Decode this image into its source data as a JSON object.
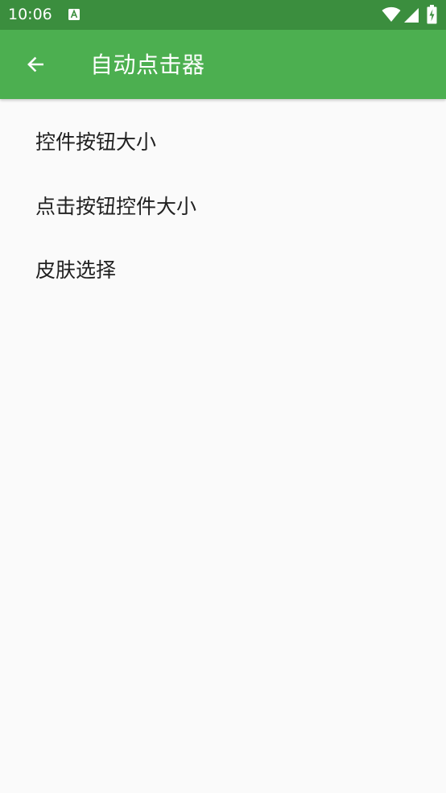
{
  "status_bar": {
    "time": "10:06",
    "notification_icon": "a-in-box-icon",
    "wifi_icon": "wifi-icon",
    "signal_icon": "cell-signal-icon",
    "battery_icon": "battery-charging-icon"
  },
  "app_bar": {
    "back_icon": "arrow-left-icon",
    "title": "自动点击器"
  },
  "settings": {
    "items": [
      {
        "label": "控件按钮大小"
      },
      {
        "label": "点击按钮控件大小"
      },
      {
        "label": "皮肤选择"
      }
    ]
  },
  "colors": {
    "status_bar": "#3b8e3e",
    "app_bar": "#4caf50",
    "background": "#fafafa",
    "text_primary": "#212121"
  }
}
